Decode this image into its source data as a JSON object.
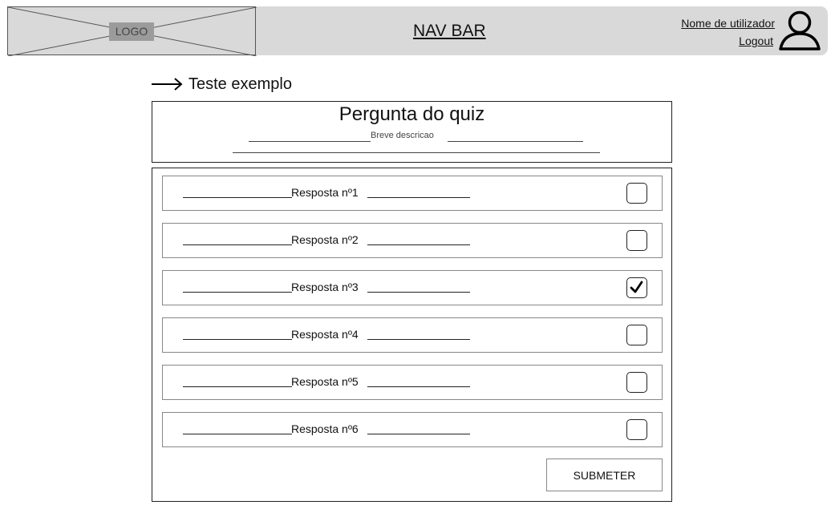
{
  "navbar": {
    "logo_text": "LOGO",
    "title": "NAV BAR",
    "user_name": "Nome de utilizador",
    "logout_label": "Logout",
    "user_icon": "user-icon"
  },
  "breadcrumb": {
    "icon": "arrow-right-icon",
    "label": "Teste exemplo"
  },
  "question": {
    "title": "Pergunta do quiz",
    "description": "Breve descricao"
  },
  "answers": [
    {
      "label": "Resposta nº1",
      "checked": false
    },
    {
      "label": "Resposta nº2",
      "checked": false
    },
    {
      "label": "Resposta nº3",
      "checked": true
    },
    {
      "label": "Resposta nº4",
      "checked": false
    },
    {
      "label": "Resposta nº5",
      "checked": false
    },
    {
      "label": "Resposta nº6",
      "checked": false
    }
  ],
  "submit_label": "SUBMETER",
  "colors": {
    "navbar_bg": "#d9d9d9",
    "logo_label_bg": "#9b9b9b",
    "border": "#222222"
  }
}
